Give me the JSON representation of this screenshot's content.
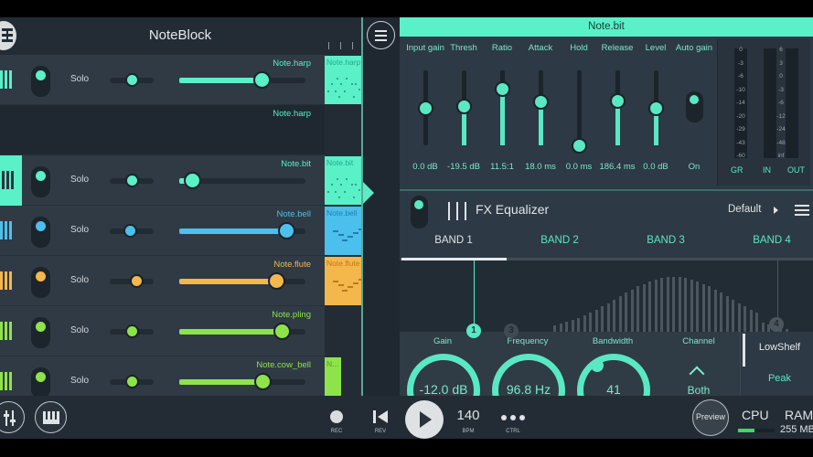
{
  "app": {
    "title": "NoteBlock"
  },
  "tracks": [
    {
      "name": "Note.harp",
      "color": "#5af0c8",
      "solo": "Solo",
      "pan": 0.5,
      "volume": 0.65,
      "muted": false,
      "keys_filled": false,
      "clip": "Note.harp",
      "empty": false
    },
    {
      "name": "Note.harp",
      "color": "#5af0c8",
      "empty": true
    },
    {
      "name": "Note.bit",
      "color": "#5af0c8",
      "solo": "Solo",
      "pan": 0.5,
      "volume": 0.1,
      "muted": false,
      "keys_filled": true,
      "clip": "Note.bit",
      "empty": false
    },
    {
      "name": "Note.bell",
      "color": "#4cc0ec",
      "solo": "Solo",
      "pan": 0.45,
      "volume": 0.85,
      "muted": false,
      "keys_filled": false,
      "clip": "Note.bell",
      "empty": false
    },
    {
      "name": "Note.flute",
      "color": "#f4b74c",
      "solo": "Solo",
      "pan": 0.6,
      "volume": 0.77,
      "muted": false,
      "keys_filled": false,
      "clip": "Note.flute",
      "empty": false
    },
    {
      "name": "Note.pling",
      "color": "#8fe34a",
      "solo": "Solo",
      "pan": 0.5,
      "volume": 0.81,
      "muted": false,
      "keys_filled": false,
      "clip": "",
      "empty": false
    },
    {
      "name": "Note.cow_bell",
      "color": "#8fe34a",
      "solo": "Solo",
      "pan": 0.5,
      "volume": 0.66,
      "muted": false,
      "keys_filled": false,
      "clip": "N...",
      "empty": false
    }
  ],
  "compressor": {
    "title": "Note.bit",
    "params": [
      {
        "label": "Input gain",
        "value": "0.0 dB",
        "level": 0.5,
        "fill": false
      },
      {
        "label": "Thresh",
        "value": "-19.5 dB",
        "level": 0.52,
        "fill": true
      },
      {
        "label": "Ratio",
        "value": "11.5:1",
        "level": 0.76,
        "fill": true
      },
      {
        "label": "Attack",
        "value": "18.0 ms",
        "level": 0.59,
        "fill": true
      },
      {
        "label": "Hold",
        "value": "0.0 ms",
        "level": 0.0,
        "fill": false
      },
      {
        "label": "Release",
        "value": "186.4 ms",
        "level": 0.6,
        "fill": true
      },
      {
        "label": "Level",
        "value": "0.0 dB",
        "level": 0.5,
        "fill": true
      }
    ],
    "auto_gain": {
      "label": "Auto gain",
      "value": "On"
    },
    "meters": {
      "gr_scale": [
        "0",
        "-3",
        "-6",
        "-10",
        "-14",
        "-20",
        "-29",
        "-43",
        "-60"
      ],
      "io_scale": [
        "6",
        "3",
        "0",
        "-3",
        "-6",
        "-12",
        "-24",
        "-48",
        "inf"
      ],
      "labels": [
        "GR",
        "IN",
        "OUT"
      ]
    }
  },
  "equalizer": {
    "title": "FX Equalizer",
    "preset": "Default",
    "bands": [
      "BAND 1",
      "BAND 2",
      "BAND 3",
      "BAND 4"
    ],
    "active_band": 0,
    "nodes": [
      "1",
      "3",
      "4"
    ],
    "controls": {
      "gain": {
        "label": "Gain",
        "value": "-12.0 dB"
      },
      "frequency": {
        "label": "Frequency",
        "value": "96.8 Hz"
      },
      "bandwidth": {
        "label": "Bandwidth",
        "value": "41"
      },
      "channel": {
        "label": "Channel",
        "value": "Both"
      }
    },
    "filter_types": [
      "LowShelf",
      "Peak"
    ],
    "selected_filter": "Peak"
  },
  "transport": {
    "rec": "REC",
    "rev": "REV",
    "bpm": "140",
    "bpm_label": "BPM",
    "ctrl_label": "CTRL",
    "preview": "Preview",
    "cpu": "CPU",
    "cpu_load": 0.45,
    "ram": "RAM",
    "ram_value": "255 MB"
  }
}
